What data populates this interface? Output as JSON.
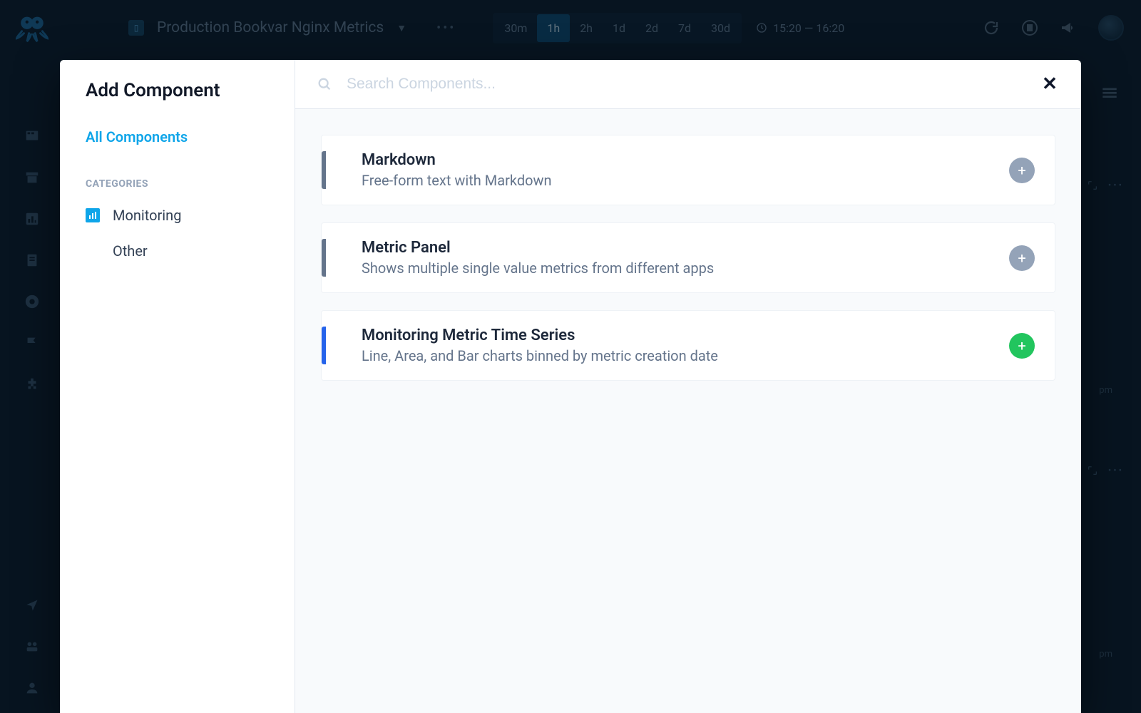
{
  "header": {
    "dashboard_title": "Production Bookvar Nginx Metrics",
    "time_options": [
      "30m",
      "1h",
      "2h",
      "1d",
      "2d",
      "7d",
      "30d"
    ],
    "time_selected": "1h",
    "time_range": "15:20 — 16:20"
  },
  "background": {
    "card_menu_dots": "•••",
    "axis_label_1": "pm",
    "axis_label_2": "pm"
  },
  "modal": {
    "title": "Add Component",
    "all_label": "All Components",
    "categories_label": "CATEGORIES",
    "categories": [
      {
        "label": "Monitoring",
        "has_icon": true
      },
      {
        "label": "Other",
        "has_icon": false
      }
    ],
    "search_placeholder": "Search Components...",
    "components": [
      {
        "name": "Markdown",
        "desc": "Free-form text with Markdown",
        "active": false
      },
      {
        "name": "Metric Panel",
        "desc": "Shows multiple single value metrics from different apps",
        "active": false
      },
      {
        "name": "Monitoring Metric Time Series",
        "desc": "Line, Area, and Bar charts binned by metric creation date",
        "active": true
      }
    ]
  }
}
